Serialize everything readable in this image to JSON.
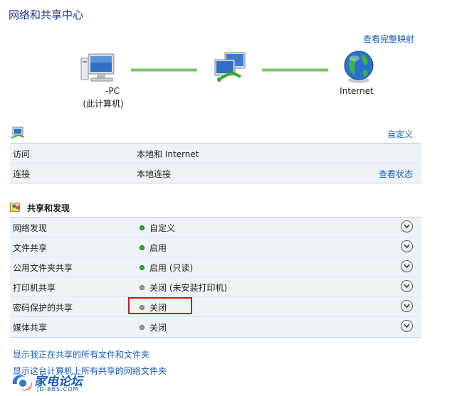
{
  "page": {
    "title": "网络和共享中心",
    "full_map_link": "查看完整映射"
  },
  "map": {
    "pc_name": "-PC",
    "pc_sub": "(此计算机)",
    "internet_label": "Internet"
  },
  "network": {
    "customize_link": "自定义",
    "rows": [
      {
        "label": "访问",
        "value": "本地和 Internet",
        "action": ""
      },
      {
        "label": "连接",
        "value": "本地连接",
        "action": "查看状态"
      }
    ]
  },
  "sharing": {
    "header": "共享和发现",
    "rows": [
      {
        "label": "网络发现",
        "value": "自定义",
        "state": "on"
      },
      {
        "label": "文件共享",
        "value": "启用",
        "state": "on"
      },
      {
        "label": "公用文件夹共享",
        "value": "启用 (只读)",
        "state": "on"
      },
      {
        "label": "打印机共享",
        "value": "关闭 (未安装打印机)",
        "state": "off"
      },
      {
        "label": "密码保护的共享",
        "value": "关闭",
        "state": "off"
      },
      {
        "label": "媒体共享",
        "value": "关闭",
        "state": "off"
      }
    ]
  },
  "footer": {
    "link1": "显示我正在共享的所有文件和文件夹",
    "link2": "显示这台计算机上所有共享的网络文件夹"
  },
  "watermark": {
    "text": "家电论坛",
    "sub": "JD-BBS.COM"
  },
  "colors": {
    "title": "#1e3287",
    "link": "#1a5bb5",
    "status_on": "#2fae2f",
    "status_off": "#9a9a9a",
    "highlight": "#d01818"
  }
}
